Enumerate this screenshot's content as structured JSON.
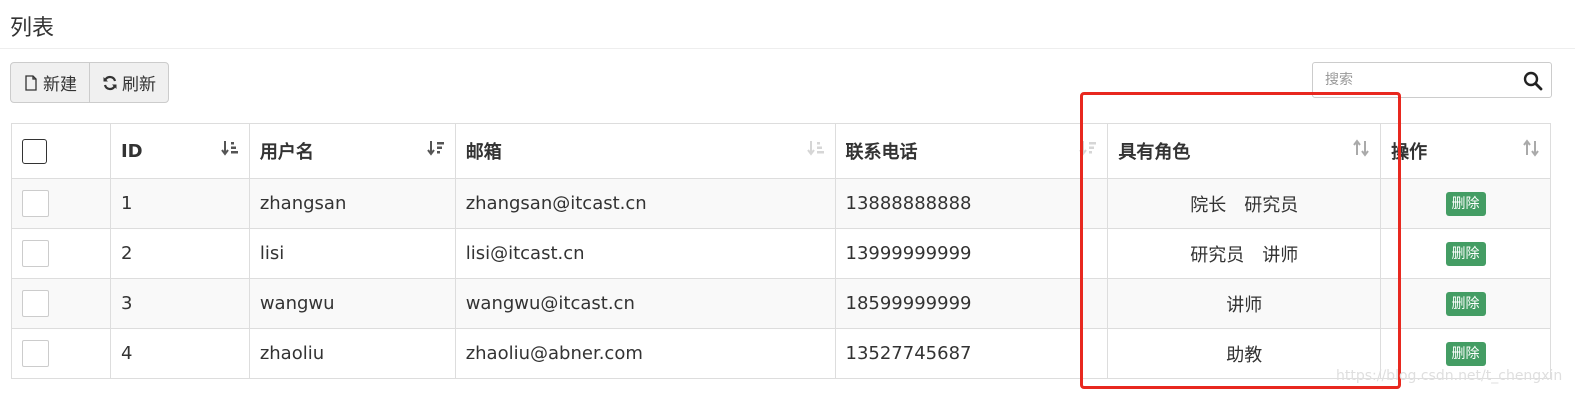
{
  "page": {
    "title": "列表"
  },
  "toolbar": {
    "new_label": "新建",
    "refresh_label": "刷新"
  },
  "search": {
    "placeholder": "搜索"
  },
  "table": {
    "columns": [
      "ID",
      "用户名",
      "邮箱",
      "联系电话",
      "具有角色",
      "操作"
    ],
    "rows": [
      {
        "id": "1",
        "username": "zhangsan",
        "email": "zhangsan@itcast.cn",
        "phone": "13888888888",
        "roles": "院长　研究员",
        "action": "删除"
      },
      {
        "id": "2",
        "username": "lisi",
        "email": "lisi@itcast.cn",
        "phone": "13999999999",
        "roles": "研究员　讲师",
        "action": "删除"
      },
      {
        "id": "3",
        "username": "wangwu",
        "email": "wangwu@itcast.cn",
        "phone": "18599999999",
        "roles": "讲师",
        "action": "删除"
      },
      {
        "id": "4",
        "username": "zhaoliu",
        "email": "zhaoliu@abner.com",
        "phone": "13527745687",
        "roles": "助教",
        "action": "删除"
      }
    ]
  },
  "colors": {
    "highlight": "#e8281f",
    "delete_button": "#449d64"
  },
  "watermark": "https://blog.csdn.net/t_chengxin"
}
